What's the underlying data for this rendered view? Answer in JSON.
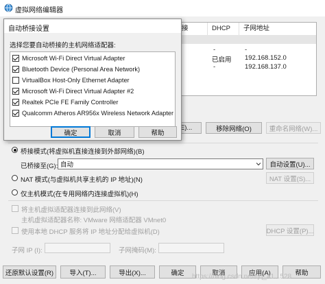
{
  "window": {
    "title": "虚拟网络编辑器"
  },
  "table": {
    "headers": [
      "",
      "DHCP",
      "子网地址"
    ],
    "header_partial_left": "接",
    "rows": [
      {
        "dhcp": "",
        "subnet": "",
        "highlight": true
      },
      {
        "dhcp": "-",
        "subnet": "-"
      },
      {
        "dhcp": "已启用",
        "subnet": "192.168.152.0"
      },
      {
        "dhcp": "-",
        "subnet": "192.168.137.0"
      }
    ]
  },
  "network_buttons": {
    "add_partial": "(E)...",
    "remove": "移除网络(O)",
    "rename": "重命名网络(W)..."
  },
  "vmnet_info": {
    "bridged_label": "桥接模式(将虚拟机直接连接到外部网络)(B)",
    "bridged_to_label": "已桥接至(G):",
    "bridged_to_value": "自动",
    "auto_settings_button": "自动设置(U)...",
    "nat_label": "NAT 模式(与虚拟机共享主机的 IP 地址)(N)",
    "nat_settings_button": "NAT 设置(S)...",
    "hostonly_label": "仅主机模式(在专用网络内连接虚拟机)(H)",
    "connect_adapter_label": "将主机虚拟适配器连接到此网络(V)",
    "adapter_name_label": "主机虚拟适配器名称: VMware 网络适配器 VMnet0",
    "dhcp_label": "使用本地 DHCP 服务将 IP 地址分配给虚拟机(D)",
    "dhcp_settings_button": "DHCP 设置(P)...",
    "subnet_ip_label": "子网 IP (I):",
    "subnet_mask_label": "子网掩码(M):"
  },
  "bottom_buttons": {
    "restore": "还原默认设置(R)",
    "import": "导入(T)...",
    "export": "导出(X)...",
    "ok": "确定",
    "cancel": "取消",
    "apply": "应用(A)",
    "help": "帮助"
  },
  "watermark": "https://blog.csdn.net/qq_41...528",
  "dialog": {
    "title": "自动桥接设置",
    "instruction": "选择您要自动桥接的主机网络适配器:",
    "adapters": [
      {
        "label": "Microsoft Wi-Fi Direct Virtual Adapter",
        "checked": true
      },
      {
        "label": "Bluetooth Device (Personal Area Network)",
        "checked": true
      },
      {
        "label": "VirtualBox Host-Only Ethernet Adapter",
        "checked": false
      },
      {
        "label": "Microsoft Wi-Fi Direct Virtual Adapter #2",
        "checked": true
      },
      {
        "label": "Realtek PCIe FE Family Controller",
        "checked": true
      },
      {
        "label": "Qualcomm Atheros AR956x Wireless Network Adapter",
        "checked": true
      }
    ],
    "ok": "确定",
    "cancel": "取消",
    "help": "帮助"
  },
  "colors": {
    "accent": "#0078d7",
    "highlight_row": "#e5e5e5",
    "window_bg": "#f0f0f0"
  }
}
